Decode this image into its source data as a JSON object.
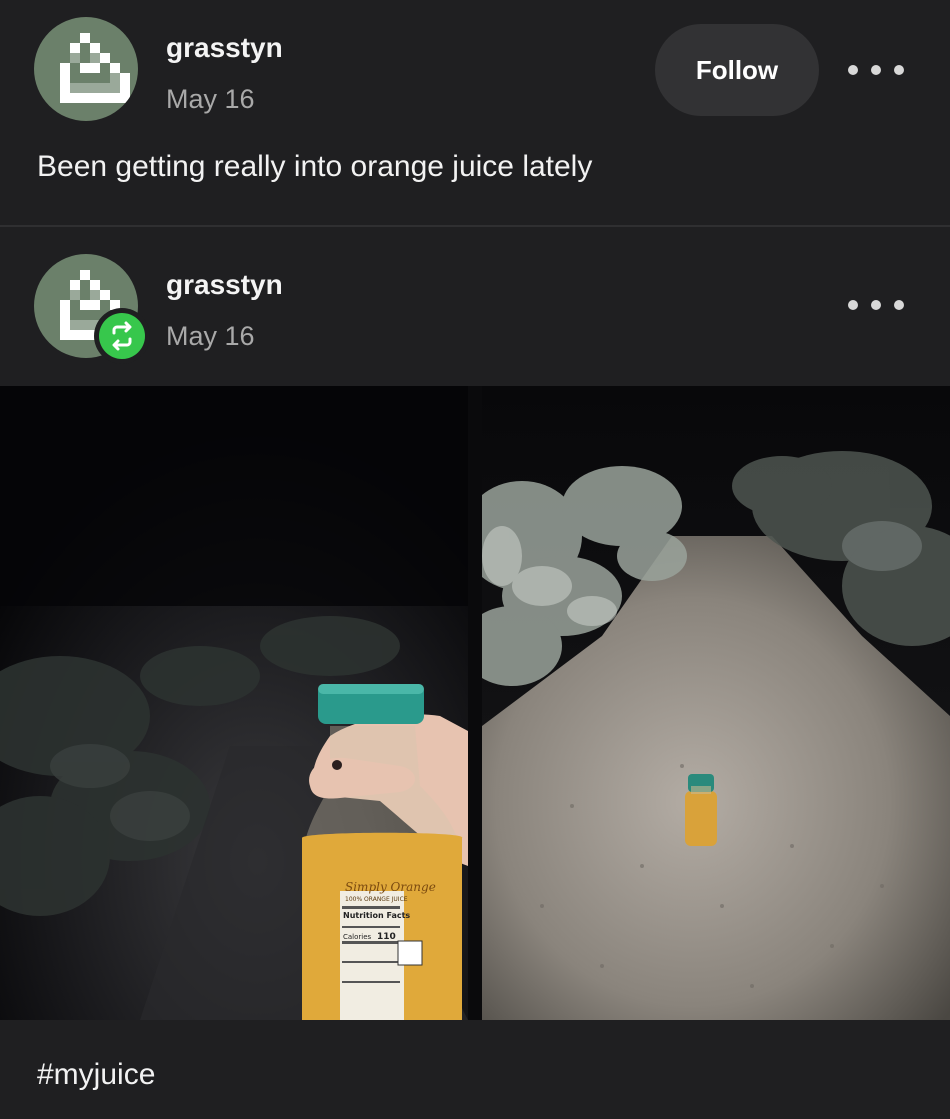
{
  "post": {
    "username": "grasstyn",
    "date": "May 16",
    "follow_label": "Follow",
    "text": "Been getting really into orange juice lately"
  },
  "reblog": {
    "username": "grasstyn",
    "date": "May 16"
  },
  "photos": {
    "bottle_label": "Simply Orange",
    "bottle_sublabel": "100% ORANGE JUICE",
    "nutrition_title": "Nutrition Facts",
    "calories_label": "Calories",
    "calories_value": "110"
  },
  "tags": [
    "#myjuice"
  ],
  "colors": {
    "background": "#1f1f21",
    "avatar_bg": "#6b806a",
    "reblog_green": "#37c74c",
    "bottle_cap": "#2a9a8c",
    "juice": "#e0a93a"
  },
  "icons": {
    "avatar": "pixel-cake-icon",
    "reblog": "reblog-icon",
    "more": "ellipsis-icon"
  }
}
